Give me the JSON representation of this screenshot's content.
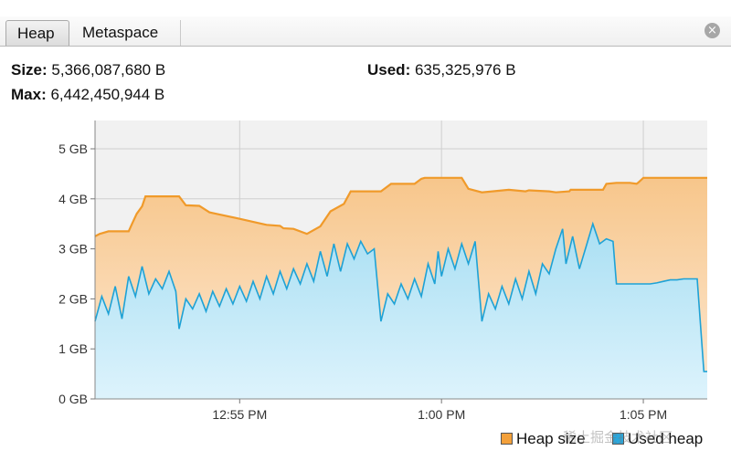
{
  "tabs": [
    {
      "label": "Heap",
      "active": true
    },
    {
      "label": "Metaspace",
      "active": false
    }
  ],
  "close_icon": "close-circle-icon",
  "stats": {
    "size_label": "Size:",
    "size_value": "5,366,087,680 B",
    "max_label": "Max:",
    "max_value": "6,442,450,944 B",
    "used_label": "Used:",
    "used_value": "635,325,976 B"
  },
  "colors": {
    "heap_line": "#f09a2a",
    "used_line": "#1ea2d6",
    "heap_fill_top": "#f7c68b",
    "heap_fill_bottom": "#fde9d4",
    "used_fill_top": "#a9dff3",
    "used_fill_bottom": "#ddf3fc",
    "legend_heap": "#f3a03a",
    "legend_used": "#2aa7dc"
  },
  "chart_data": {
    "type": "area",
    "xlabel": "",
    "ylabel": "",
    "ylim": [
      0,
      5.5
    ],
    "y_unit": "GB",
    "y_ticks": [
      {
        "value": 0,
        "label": "0 GB"
      },
      {
        "value": 1,
        "label": "1 GB"
      },
      {
        "value": 2,
        "label": "2 GB"
      },
      {
        "value": 3,
        "label": "3 GB"
      },
      {
        "value": 4,
        "label": "4 GB"
      },
      {
        "value": 5,
        "label": "5 GB"
      }
    ],
    "xlim": [
      "12:51:25",
      "1:06:35"
    ],
    "x_ticks": [
      {
        "value": "12:55",
        "label": "12:55 PM"
      },
      {
        "value": "1:00",
        "label": "1:00 PM"
      },
      {
        "value": "1:05",
        "label": "1:05 PM"
      }
    ],
    "grid": true,
    "legend": {
      "placement": "bottom-right",
      "entries": [
        "Heap size",
        "Used heap"
      ]
    },
    "series": [
      {
        "name": "Heap size",
        "x": [
          "12:51:25",
          "12:51:32",
          "12:51:45",
          "12:52:15",
          "12:52:20",
          "12:52:27",
          "12:52:35",
          "12:52:40",
          "12:53:12",
          "12:53:30",
          "12:53:40",
          "12:54:00",
          "12:54:15",
          "12:54:25",
          "12:55:00",
          "12:55:30",
          "12:55:40",
          "12:56:00",
          "12:56:05",
          "12:56:20",
          "12:56:40",
          "12:57:00",
          "12:57:15",
          "12:57:35",
          "12:57:45",
          "12:58:30",
          "12:58:45",
          "12:59:20",
          "12:59:30",
          "12:59:35",
          "12:59:50",
          "1:00:30",
          "1:00:40",
          "1:01:00",
          "1:01:40",
          "1:02:05",
          "1:02:10",
          "1:02:40",
          "1:02:50",
          "1:03:10",
          "1:03:12",
          "1:03:25",
          "1:03:35",
          "1:04:00",
          "1:04:05",
          "1:04:20",
          "1:04:30",
          "1:04:40",
          "1:04:50",
          "1:04:52",
          "1:05:00",
          "1:06:35"
        ],
        "values": [
          3.25,
          3.3,
          3.35,
          3.35,
          3.5,
          3.7,
          3.85,
          4.05,
          4.05,
          4.05,
          3.87,
          3.86,
          3.73,
          3.7,
          3.6,
          3.51,
          3.48,
          3.46,
          3.41,
          3.4,
          3.3,
          3.45,
          3.75,
          3.9,
          4.15,
          4.15,
          4.3,
          4.3,
          4.4,
          4.42,
          4.42,
          4.42,
          4.2,
          4.13,
          4.18,
          4.15,
          4.17,
          4.15,
          4.13,
          4.15,
          4.18,
          4.18,
          4.18,
          4.18,
          4.3,
          4.32,
          4.32,
          4.32,
          4.3,
          4.32,
          4.42,
          4.42
        ]
      },
      {
        "name": "Used heap",
        "x": [
          "12:51:25",
          "12:51:35",
          "12:51:45",
          "12:51:55",
          "12:52:05",
          "12:52:15",
          "12:52:25",
          "12:52:35",
          "12:52:45",
          "12:52:55",
          "12:53:05",
          "12:53:15",
          "12:53:25",
          "12:53:30",
          "12:53:40",
          "12:53:50",
          "12:54:00",
          "12:54:10",
          "12:54:20",
          "12:54:30",
          "12:54:40",
          "12:54:50",
          "12:55:00",
          "12:55:10",
          "12:55:20",
          "12:55:30",
          "12:55:40",
          "12:55:50",
          "12:56:00",
          "12:56:10",
          "12:56:20",
          "12:56:30",
          "12:56:40",
          "12:56:50",
          "12:57:00",
          "12:57:10",
          "12:57:20",
          "12:57:30",
          "12:57:40",
          "12:57:50",
          "12:58:00",
          "12:58:10",
          "12:58:20",
          "12:58:30",
          "12:58:40",
          "12:58:50",
          "12:59:00",
          "12:59:10",
          "12:59:20",
          "12:59:30",
          "12:59:40",
          "12:59:50",
          "12:59:55",
          "1:00:00",
          "1:00:10",
          "1:00:20",
          "1:00:30",
          "1:00:40",
          "1:00:50",
          "1:01:00",
          "1:01:10",
          "1:01:20",
          "1:01:30",
          "1:01:40",
          "1:01:50",
          "1:02:00",
          "1:02:10",
          "1:02:20",
          "1:02:30",
          "1:02:40",
          "1:02:50",
          "1:03:00",
          "1:03:05",
          "1:03:15",
          "1:03:25",
          "1:03:35",
          "1:03:45",
          "1:03:55",
          "1:04:05",
          "1:04:15",
          "1:04:20",
          "1:04:30",
          "1:04:40",
          "1:04:50",
          "1:05:00",
          "1:05:10",
          "1:05:20",
          "1:05:30",
          "1:05:40",
          "1:05:50",
          "1:06:00",
          "1:06:10",
          "1:06:15",
          "1:06:20",
          "1:06:30",
          "1:06:35"
        ],
        "values": [
          1.55,
          2.05,
          1.7,
          2.25,
          1.6,
          2.45,
          2.05,
          2.65,
          2.1,
          2.4,
          2.2,
          2.55,
          2.15,
          1.4,
          2.0,
          1.8,
          2.1,
          1.75,
          2.15,
          1.85,
          2.2,
          1.9,
          2.25,
          1.95,
          2.35,
          2.0,
          2.45,
          2.1,
          2.55,
          2.2,
          2.6,
          2.3,
          2.7,
          2.35,
          2.95,
          2.45,
          3.1,
          2.55,
          3.1,
          2.8,
          3.15,
          2.9,
          3.0,
          1.55,
          2.1,
          1.9,
          2.3,
          2.0,
          2.4,
          2.05,
          2.7,
          2.3,
          2.95,
          2.45,
          3.0,
          2.6,
          3.1,
          2.7,
          3.15,
          1.55,
          2.1,
          1.8,
          2.25,
          1.9,
          2.4,
          2.0,
          2.55,
          2.1,
          2.7,
          2.5,
          3.0,
          3.4,
          2.7,
          3.25,
          2.6,
          3.05,
          3.5,
          3.1,
          3.2,
          3.15,
          2.3,
          2.3,
          2.3,
          2.3,
          2.3,
          2.3,
          2.32,
          2.35,
          2.38,
          2.38,
          2.4,
          2.4,
          2.4,
          2.4,
          0.55,
          0.55
        ]
      }
    ]
  },
  "watermark": "稀土掘金技术社区"
}
